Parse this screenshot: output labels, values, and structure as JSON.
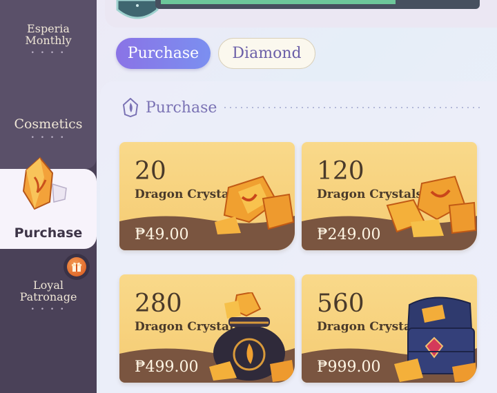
{
  "sidebar": {
    "items": [
      {
        "label_line1": "Esperia",
        "label_line2": "Monthly",
        "dots": "• • • •"
      },
      {
        "label": "Cosmetics",
        "dots": "• • • •"
      },
      {
        "label": "Purchase"
      },
      {
        "label_line1": "Loyal",
        "label_line2": "Patronage",
        "dots": "• • • •"
      }
    ]
  },
  "tabs": [
    {
      "label": "Purchase",
      "active": true
    },
    {
      "label": "Diamond",
      "active": false
    }
  ],
  "section": {
    "title": "Purchase"
  },
  "products": [
    {
      "amount": "20",
      "unit": "Dragon Crystals",
      "price": "₱49.00"
    },
    {
      "amount": "120",
      "unit": "Dragon Crystals",
      "price": "₱249.00"
    },
    {
      "amount": "280",
      "unit": "Dragon Crystals",
      "price": "₱499.00"
    },
    {
      "amount": "560",
      "unit": "Dragon Crystals",
      "price": "₱999.00"
    }
  ],
  "colors": {
    "sidebar": "#4a4158",
    "tab_active": "#8a73e6",
    "card": "#f5cb72",
    "price_band": "#7a5540"
  }
}
